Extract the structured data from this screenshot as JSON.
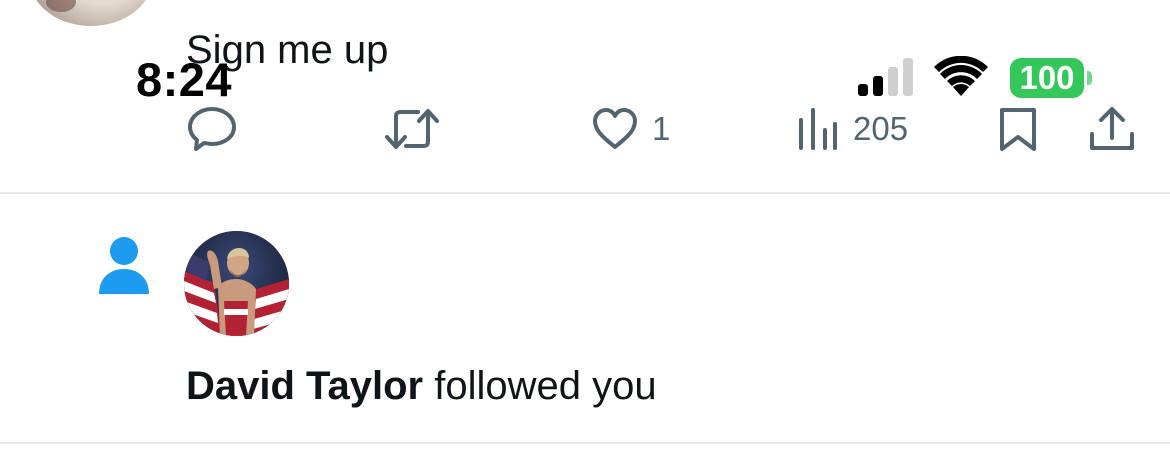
{
  "status_bar": {
    "time": "8:24",
    "battery_level": "100",
    "battery_color": "#34c759",
    "signal_bars_active": 2,
    "signal_bars_total": 4
  },
  "previous_tweet": {
    "text": "Sign me up",
    "actions": {
      "reply_icon": "reply-icon",
      "retweet_icon": "retweet-icon",
      "like_icon": "heart-icon",
      "like_count": "1",
      "views_icon": "views-chart-icon",
      "views_count": "205",
      "bookmark_icon": "bookmark-icon",
      "share_icon": "share-icon"
    }
  },
  "notification": {
    "type_icon": "person-icon",
    "type_icon_color": "#1d9bf0",
    "name": "David Taylor",
    "action_text": " followed you"
  },
  "colors": {
    "text_primary": "#0f1419",
    "text_secondary": "#536471",
    "divider": "#e6e8ea"
  }
}
